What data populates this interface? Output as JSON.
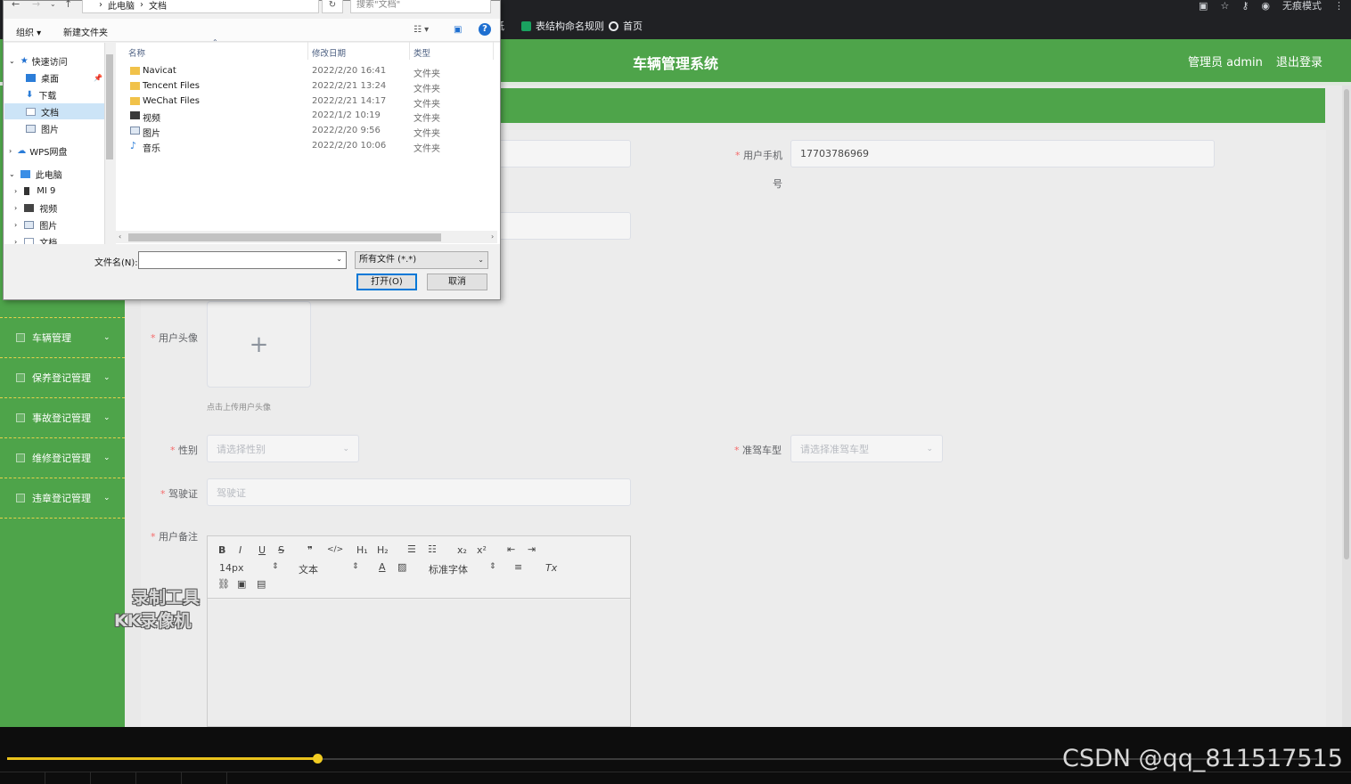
{
  "browser": {
    "bookmarks": [
      {
        "label": "纸",
        "icon": "bookmark-icon"
      },
      {
        "label": "表结构命名规则",
        "icon": "sheet-icon"
      },
      {
        "label": "首页",
        "icon": "globe-icon"
      }
    ],
    "incognito_label": "无痕模式"
  },
  "app": {
    "title": "车辆管理系统",
    "admin_label": "管理员 admin",
    "logout_label": "退出登录",
    "accent_color": "#4ea44a"
  },
  "sidebar": {
    "items": [
      {
        "label": "车辆管理"
      },
      {
        "label": "保养登记管理"
      },
      {
        "label": "事故登记管理"
      },
      {
        "label": "维修登记管理"
      },
      {
        "label": "违章登记管理"
      }
    ]
  },
  "form": {
    "phone_label": "用户手机号",
    "phone_label_line1": "用户手机",
    "phone_label_line2": "号",
    "phone_value": "17703786969",
    "avatar_label": "用户头像",
    "avatar_hint": "点击上传用户头像",
    "avatar_plus": "+",
    "gender_label": "性别",
    "gender_placeholder": "请选择性别",
    "vehicle_type_label": "准驾车型",
    "vehicle_type_placeholder": "请选择准驾车型",
    "license_label": "驾驶证",
    "license_placeholder": "驾驶证",
    "notes_label": "用户备注",
    "required_mark": "*"
  },
  "editor": {
    "bold": "B",
    "italic": "I",
    "underline": "U",
    "strike": "S",
    "quote": "❞",
    "code": "</>",
    "h1": "H₁",
    "h2": "H₂",
    "sub": "x₂",
    "sup": "x²",
    "size": "14px",
    "text_style": "文本",
    "font_family": "标准字体",
    "clean": "Tx"
  },
  "watermark": {
    "line1": "录制工具",
    "line2": "KK录像机"
  },
  "player": {
    "progress": 0.237,
    "credit": "CSDN @qq_811517515"
  },
  "file_dialog": {
    "breadcrumb": [
      "此电脑",
      "文档"
    ],
    "search_placeholder": "搜索\"文档\"",
    "organize_label": "组织 ▾",
    "new_folder_label": "新建文件夹",
    "help": "?",
    "nav": [
      {
        "label": "快速访问",
        "icon": "star-icon"
      },
      {
        "label": "桌面",
        "icon": "desktop-icon"
      },
      {
        "label": "下载",
        "icon": "download-icon"
      },
      {
        "label": "文档",
        "icon": "document-icon"
      },
      {
        "label": "图片",
        "icon": "picture-icon"
      },
      {
        "label": "WPS网盘",
        "icon": "cloud-icon"
      },
      {
        "label": "此电脑",
        "icon": "computer-icon"
      },
      {
        "label": "MI 9",
        "icon": "phone-icon"
      },
      {
        "label": "视频",
        "icon": "video-icon"
      },
      {
        "label": "图片",
        "icon": "picture-icon"
      },
      {
        "label": "文档",
        "icon": "document-icon"
      }
    ],
    "columns": {
      "name": "名称",
      "date": "修改日期",
      "type": "类型"
    },
    "files": [
      {
        "name": "Navicat",
        "date": "2022/2/20 16:41",
        "type": "文件夹",
        "icon": "folder-icon"
      },
      {
        "name": "Tencent Files",
        "date": "2022/2/21 13:24",
        "type": "文件夹",
        "icon": "folder-icon"
      },
      {
        "name": "WeChat Files",
        "date": "2022/2/21 14:17",
        "type": "文件夹",
        "icon": "folder-icon"
      },
      {
        "name": "视频",
        "date": "2022/1/2 10:19",
        "type": "文件夹",
        "icon": "video-folder-icon"
      },
      {
        "name": "图片",
        "date": "2022/2/20 9:56",
        "type": "文件夹",
        "icon": "picture-folder-icon"
      },
      {
        "name": "音乐",
        "date": "2022/2/20 10:06",
        "type": "文件夹",
        "icon": "music-folder-icon"
      }
    ],
    "filename_label": "文件名(N):",
    "filter_value": "所有文件 (*.*)",
    "open_label": "打开(O)",
    "cancel_label": "取消"
  }
}
